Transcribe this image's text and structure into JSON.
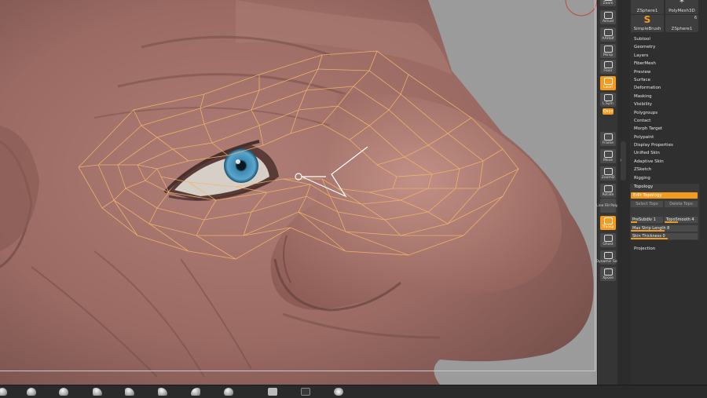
{
  "shelf": {
    "buttons": [
      {
        "label": "Zoom",
        "active": false
      },
      {
        "label": "Actual",
        "active": false
      },
      {
        "label": "AAHalf",
        "active": false
      },
      {
        "label": "Persp",
        "active": false
      },
      {
        "label": "Floor",
        "active": false
      },
      {
        "label": "Local",
        "active": true
      },
      {
        "label": "L.Sym",
        "active": false
      },
      {
        "label": "Qxyz",
        "active": true
      },
      {
        "label": "Frame",
        "active": false
      },
      {
        "label": "Move",
        "active": false
      },
      {
        "label": "ZoomD",
        "active": false
      },
      {
        "label": "Rotate",
        "active": false
      },
      {
        "label": "Line Fill PolyF",
        "active": false
      },
      {
        "label": "Transp",
        "active": true
      },
      {
        "label": "Ghost",
        "active": false
      },
      {
        "label": "Dynamic Solo",
        "active": false
      },
      {
        "label": "Xpose",
        "active": false
      }
    ]
  },
  "palette": {
    "thumbs_row1": [
      {
        "label": "ZSphere1",
        "count": ""
      },
      {
        "label": "PolyMesh3D",
        "count": ""
      }
    ],
    "thumbs_row2": [
      {
        "label": "SimpleBrush",
        "count": ""
      },
      {
        "label": "ZSphere1",
        "count": "6"
      }
    ],
    "menu": [
      "Subtool",
      "Geometry",
      "Layers",
      "FiberMesh",
      "Preview",
      "Surface",
      "Deformation",
      "Masking",
      "Visibility",
      "Polygroups",
      "Contact",
      "Morph Target",
      "Polypaint",
      "Display Properties",
      "Unified Skin",
      "Adaptive Skin",
      "ZSketch",
      "Rigging"
    ],
    "topology": {
      "title": "Topology",
      "edit_label": "Edit Topology",
      "select_topo": "Select Topo",
      "delete_topo": "Delete Topo",
      "presubdiv_label": "PreSubdiv",
      "presubdiv_value": "1",
      "presubdiv_fill": 0.2,
      "toposmooth_label": "TopoSmooth",
      "toposmooth_value": "4",
      "toposmooth_fill": 0.4,
      "maxstrip_label": "Max Strip Length",
      "maxstrip_value": "8",
      "maxstrip_fill": 0.5,
      "skin_label": "Skin Thickness",
      "skin_value": "0",
      "skin_fill": 0.55
    },
    "projection": "Projection"
  },
  "colors": {
    "accent": "#f39b1e",
    "topology_lines": "#f2b36a"
  },
  "icons": {
    "brush_thumbs": [
      "sphere-brush-icon",
      "sphere-brush-icon",
      "sphere-brush-icon",
      "clay-brush-icon",
      "clay-brush-icon",
      "clay-brush-icon",
      "clay-brush-icon",
      "sphere-brush-icon",
      "stroke-icon",
      "alpha-icon",
      "texture-icon"
    ]
  }
}
